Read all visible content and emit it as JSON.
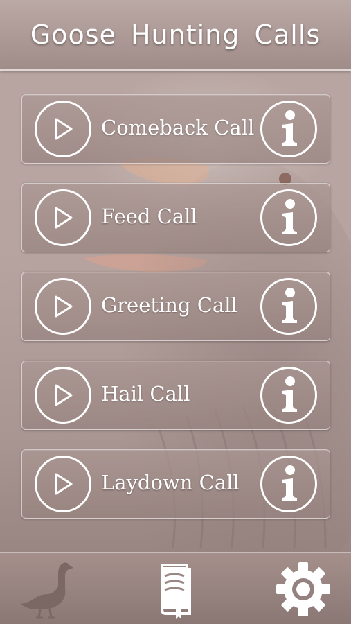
{
  "header": {
    "title": "Goose Hunting Calls"
  },
  "calls": [
    {
      "label": "Comeback Call",
      "play_icon": "play-icon",
      "info_icon": "info-icon"
    },
    {
      "label": "Feed Call",
      "play_icon": "play-icon",
      "info_icon": "info-icon"
    },
    {
      "label": "Greeting Call",
      "play_icon": "play-icon",
      "info_icon": "info-icon"
    },
    {
      "label": "Hail Call",
      "play_icon": "play-icon",
      "info_icon": "info-icon"
    },
    {
      "label": "Laydown Call",
      "play_icon": "play-icon",
      "info_icon": "info-icon"
    }
  ],
  "footer": {
    "tabs": [
      {
        "icon": "goose-icon",
        "selected": true
      },
      {
        "icon": "book-icon",
        "selected": false
      },
      {
        "icon": "gear-icon",
        "selected": false
      }
    ]
  },
  "colors": {
    "background": "#b7a39f",
    "header": "#a08c88",
    "row": "#9a8682",
    "text": "#ffffff",
    "selected_tab": "#7f6b66"
  }
}
